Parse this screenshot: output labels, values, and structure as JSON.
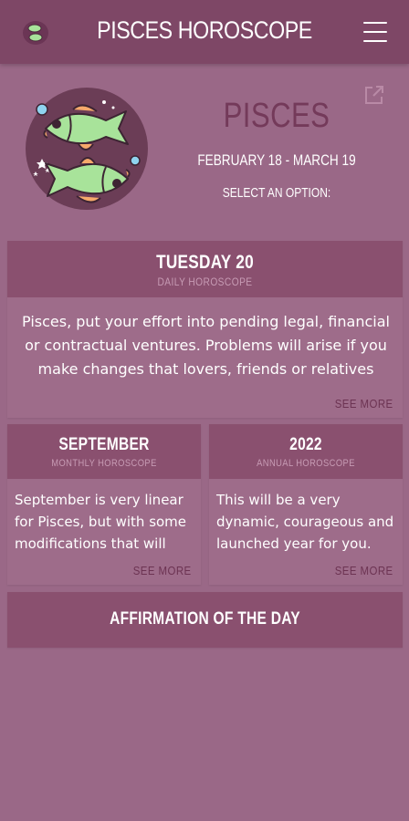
{
  "header": {
    "title": "PISCES HOROSCOPE",
    "logo_icon": "pisces-fish-logo",
    "menu_icon": "hamburger-menu"
  },
  "sign": {
    "name": "PISCES",
    "dates": "FEBRUARY 18 - MARCH 19",
    "select_label": "SELECT AN OPTION:"
  },
  "daily": {
    "title": "TUESDAY 20",
    "subtitle": "DAILY HOROSCOPE",
    "text": "Pisces, put your effort into pending legal, financial or contractual ventures. Problems will arise if you make changes that lovers, friends or relatives don't agree…",
    "see_more": "SEE MORE"
  },
  "monthly": {
    "title": "SEPTEMBER",
    "subtitle": "MONTHLY HOROSCOPE",
    "text": "September is very linear for Pisces, but with some modifications that will ma…",
    "see_more": "SEE MORE"
  },
  "annual": {
    "title": "2022",
    "subtitle": "ANNUAL HOROSCOPE",
    "text": "This will be a very dynamic, courageous and launched year for you. You will ado…",
    "see_more": "SEE MORE"
  },
  "affirmation": {
    "title": "AFFIRMATION OF THE DAY"
  },
  "colors": {
    "background": "#9a6887",
    "appbar": "#7e4766",
    "card_header": "#8a506f",
    "sign_name": "#743a5a",
    "fish_green": "#a8e39a"
  }
}
